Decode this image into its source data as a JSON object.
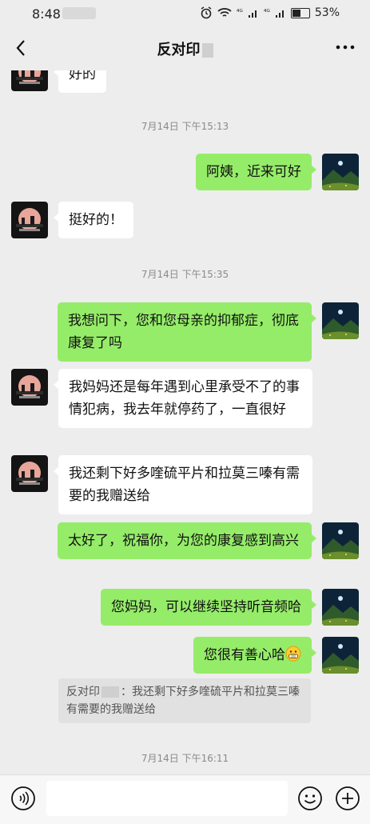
{
  "status_bar": {
    "time": "8:48",
    "signal_1": "⁴ᴳ",
    "signal_2": "⁴ᴳ",
    "battery": "53%"
  },
  "nav": {
    "title": "反对印"
  },
  "messages": [
    {
      "kind": "left-text",
      "text": "好的"
    },
    {
      "kind": "timestamp",
      "text": "7月14日 下午15:13"
    },
    {
      "kind": "right-text",
      "text": "阿姨，近来可好"
    },
    {
      "kind": "left-text",
      "text": "挺好的！"
    },
    {
      "kind": "timestamp",
      "text": "7月14日 下午15:35"
    },
    {
      "kind": "right-text",
      "text": "我想问下，您和您母亲的抑郁症，彻底康复了吗"
    },
    {
      "kind": "left-text",
      "text": "我妈妈还是每年遇到心里承受不了的事情犯病，我去年就停药了，一直很好"
    },
    {
      "kind": "left-text",
      "text": "我还剩下好多喹硫平片和拉莫三嗪有需要的我赠送给"
    },
    {
      "kind": "right-text",
      "text": "太好了，祝福你，为您的康复感到高兴"
    },
    {
      "kind": "right-text",
      "text": "您妈妈，可以继续坚持听音频哈"
    },
    {
      "kind": "right-text",
      "text": "您很有善心哈"
    },
    {
      "kind": "timestamp",
      "text": "7月14日 下午16:11"
    }
  ],
  "quote": {
    "sender": "反对印",
    "separator": "：",
    "text": "我还剩下好多喹硫平片和拉莫三嗪有需要的我赠送给"
  },
  "icons": {
    "back": "chevron-left-icon",
    "more": "more-dots-icon",
    "voice": "voice-icon",
    "emoji": "emoji-icon",
    "plus": "plus-icon",
    "grin": "grin-emoji"
  },
  "colors": {
    "background": "#ededed",
    "sent_bubble": "#95ec69",
    "received_bubble": "#ffffff",
    "timestamp": "#8a8a8a"
  }
}
